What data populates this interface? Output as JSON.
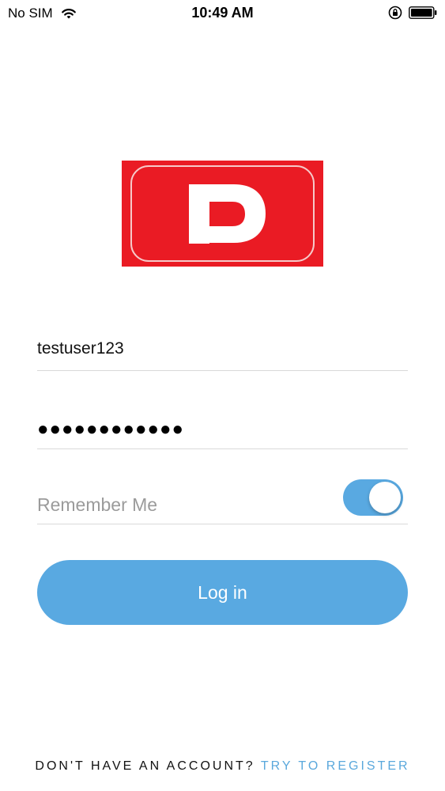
{
  "status_bar": {
    "carrier": "No SIM",
    "time": "10:49 AM"
  },
  "logo": {
    "letter": "P",
    "color": "#ea1b24"
  },
  "form": {
    "username_value": "testuser123",
    "password_value": "●●●●●●●●●●●●",
    "remember_label": "Remember Me",
    "remember_on": true,
    "login_label": "Log in"
  },
  "footer": {
    "prompt": "DON'T HAVE AN ACCOUNT?",
    "register_label": "TRY TO REGISTER"
  },
  "colors": {
    "accent": "#59a9e1",
    "link": "#5aa8dc",
    "logo_red": "#ea1b24"
  }
}
